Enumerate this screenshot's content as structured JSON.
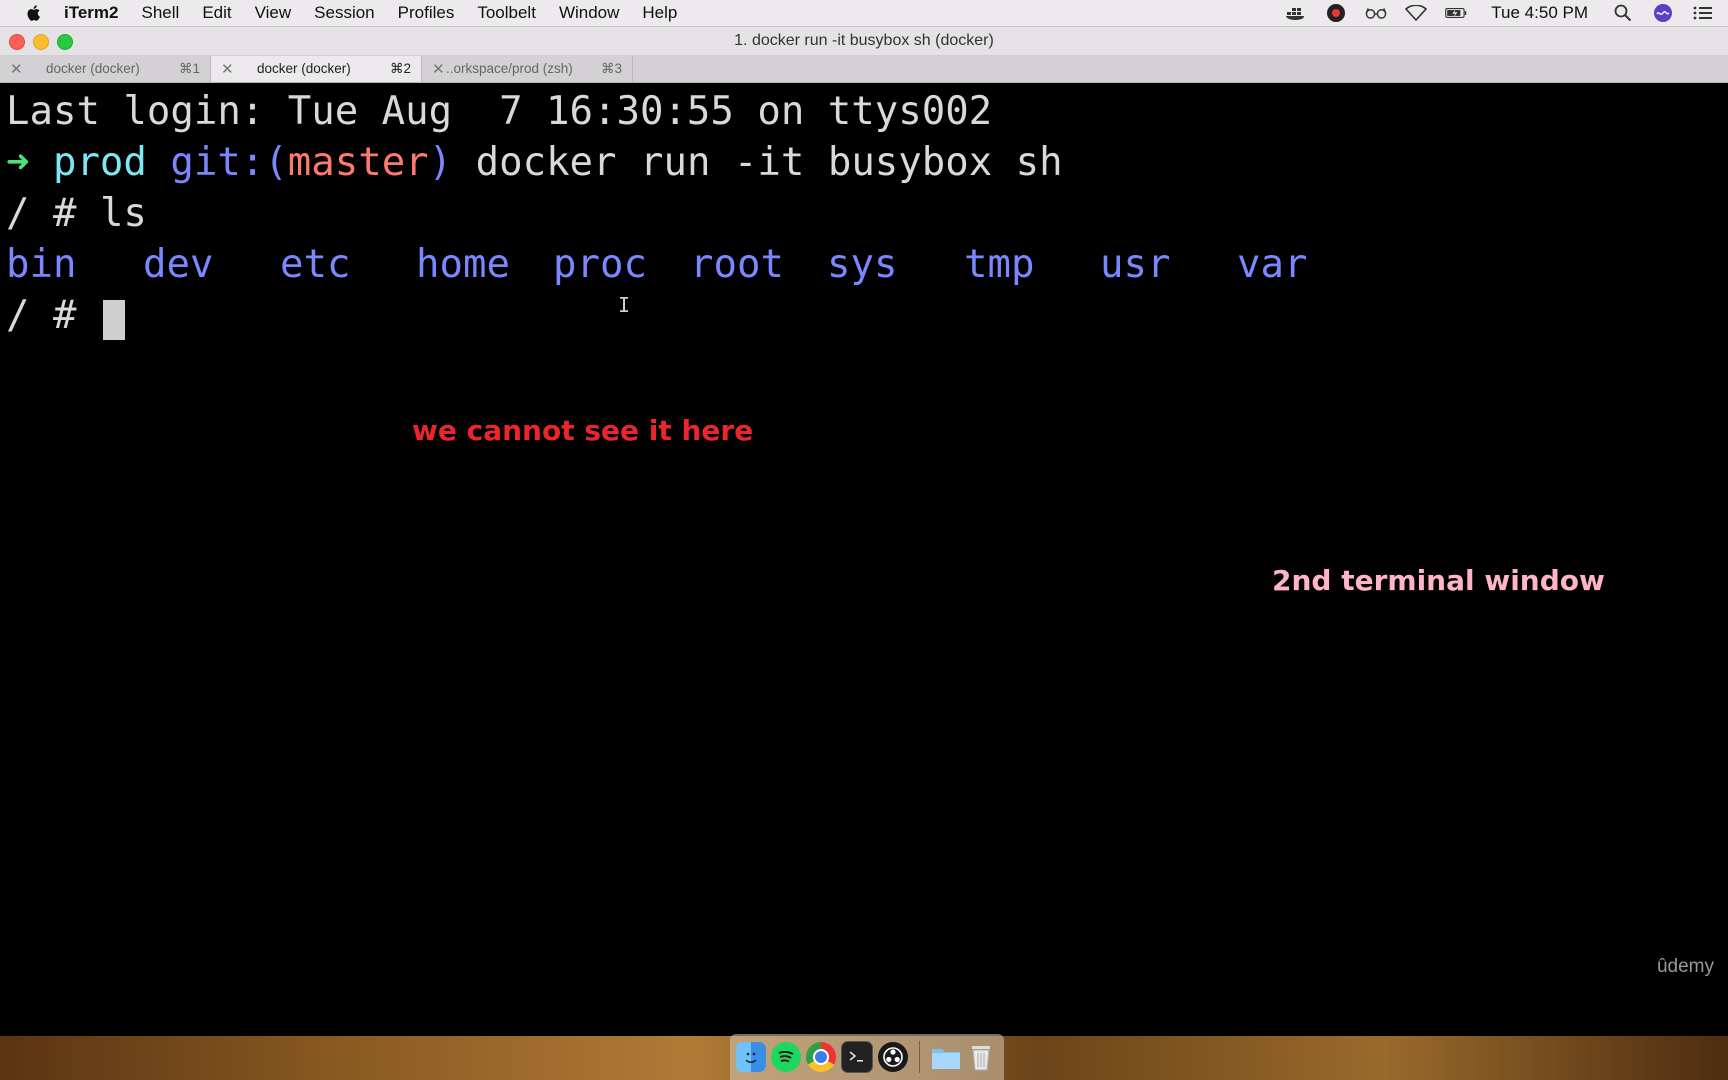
{
  "menubar": {
    "app_name": "iTerm2",
    "items": [
      "Shell",
      "Edit",
      "View",
      "Session",
      "Profiles",
      "Toolbelt",
      "Window",
      "Help"
    ],
    "clock": "Tue 4:50 PM",
    "status_icons": [
      "docker-icon",
      "obs-icon",
      "glasses-icon",
      "wifi-icon",
      "battery-icon",
      "spotlight-icon",
      "siri-icon",
      "notification-center-icon"
    ]
  },
  "window": {
    "title": "1. docker run -it busybox sh (docker)"
  },
  "tabs": [
    {
      "label": "docker (docker)",
      "shortcut": "⌘1",
      "active": false
    },
    {
      "label": "docker (docker)",
      "shortcut": "⌘2",
      "active": true
    },
    {
      "label": "..orkspace/prod (zsh)",
      "shortcut": "⌘3",
      "active": false
    }
  ],
  "terminal": {
    "last_login": "Last login: Tue Aug  7 16:30:55 on ttys002",
    "prompt_arrow": "➜",
    "prompt_dir": "prod",
    "prompt_git_prefix": "git:(",
    "prompt_branch": "master",
    "prompt_git_suffix": ")",
    "command": "docker run -it busybox sh",
    "sh_prompt": "/ #",
    "ls_command": "ls",
    "directories": [
      "bin",
      "dev",
      "etc",
      "home",
      "proc",
      "root",
      "sys",
      "tmp",
      "usr",
      "var"
    ],
    "cursor_prompt": "/ #"
  },
  "annotations": {
    "red_note": "we cannot see it here",
    "pink_note": "2nd terminal window"
  },
  "watermark": "ûdemy",
  "colors": {
    "prompt_arrow": "#4fe07a",
    "prompt_dir": "#7ee7f5",
    "git": "#7b87ff",
    "branch": "#ff7a6e",
    "directories": "#7b87ff",
    "red_note": "#e8262b",
    "pink_note": "#ffb4c8"
  },
  "dock": {
    "icons": [
      "finder-icon",
      "spotify-icon",
      "chrome-icon",
      "terminal-icon",
      "obs-icon",
      "folder-icon",
      "trash-icon"
    ]
  }
}
